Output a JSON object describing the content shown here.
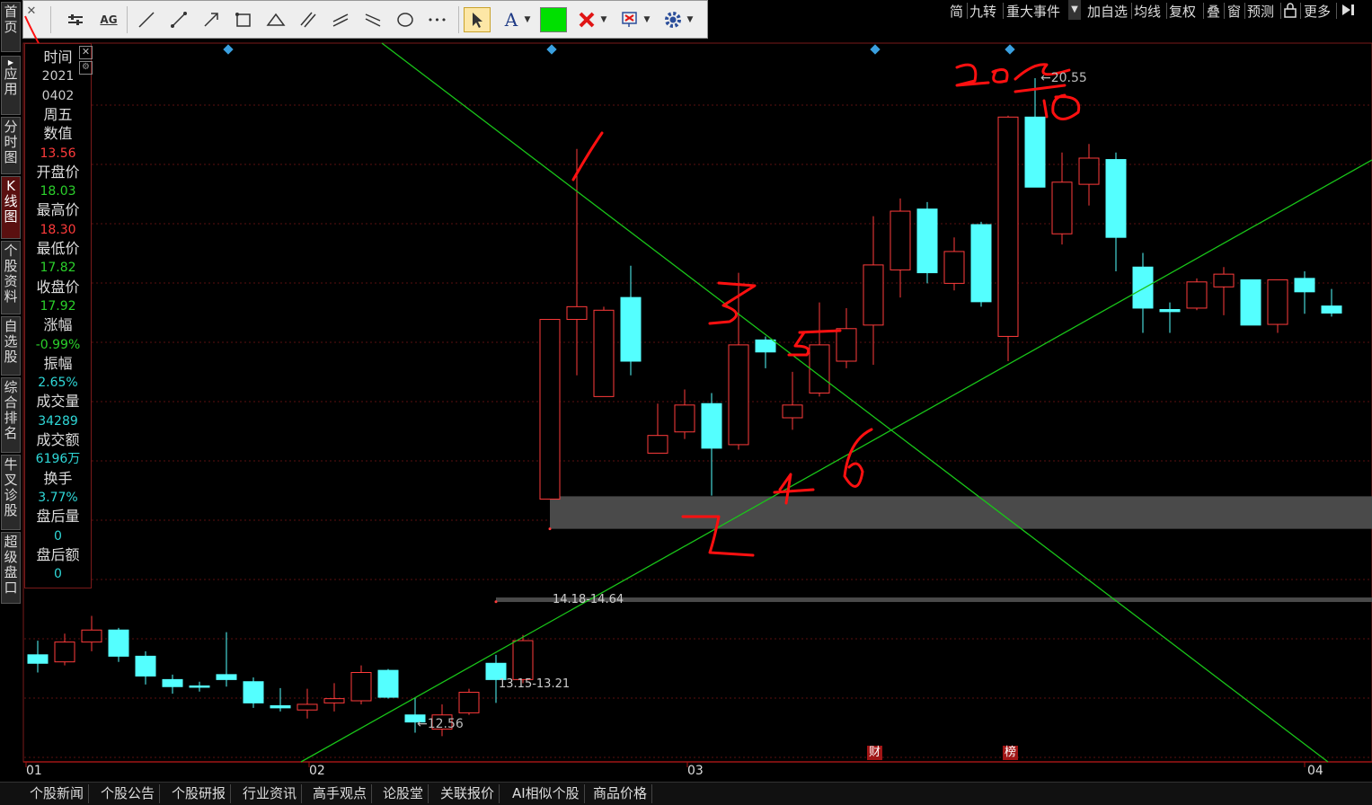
{
  "left_nav": [
    {
      "label": "首页",
      "active": false
    },
    {
      "label": "应用",
      "active": false,
      "arrow": true
    },
    {
      "label": "分时图",
      "active": false
    },
    {
      "label": "K线图",
      "active": true
    },
    {
      "label": "个股资料",
      "active": false
    },
    {
      "label": "自选股",
      "active": false
    },
    {
      "label": "综合排名",
      "active": false
    },
    {
      "label": "牛叉诊股",
      "active": false
    },
    {
      "label": "超级盘口",
      "active": false
    }
  ],
  "toolbar": {
    "close": "✕",
    "text_tool": "A",
    "ag_label": "AG",
    "more": "•••",
    "color": "#00e000"
  },
  "top_menu": [
    "简",
    "九转",
    "重大事件",
    "加自选",
    "均线",
    "复权",
    "叠",
    "窗",
    "预测",
    "更多"
  ],
  "info_panel": {
    "rows": [
      {
        "label": "时间",
        "value": null
      },
      {
        "label": null,
        "value": "2021",
        "color": "white"
      },
      {
        "label": null,
        "value": "0402",
        "color": "white"
      },
      {
        "label": null,
        "value": "周五",
        "color": "label"
      },
      {
        "label": "数值",
        "value": "13.56",
        "color": "red"
      },
      {
        "label": "开盘价",
        "value": "18.03",
        "color": "green"
      },
      {
        "label": "最高价",
        "value": "18.30",
        "color": "red"
      },
      {
        "label": "最低价",
        "value": "17.82",
        "color": "green"
      },
      {
        "label": "收盘价",
        "value": "17.92",
        "color": "green"
      },
      {
        "label": "涨幅",
        "value": "-0.99%",
        "color": "green"
      },
      {
        "label": "振幅",
        "value": "2.65%",
        "color": "cyan"
      },
      {
        "label": "成交量",
        "value": "34289",
        "color": "cyan"
      },
      {
        "label": "成交额",
        "value": "6196万",
        "color": "cyan"
      },
      {
        "label": "换手",
        "value": "3.77%",
        "color": "cyan"
      },
      {
        "label": "盘后量",
        "value": "0",
        "color": "cyan"
      },
      {
        "label": "盘后额",
        "value": "0",
        "color": "cyan"
      }
    ]
  },
  "bottom_tabs": [
    "个股新闻",
    "个股公告",
    "个股研报",
    "行业资讯",
    "高手观点",
    "论股堂",
    "关联报价",
    "AI相似个股",
    "商品价格"
  ],
  "chart_data": {
    "type": "candlestick",
    "x_axis_labels": [
      "01",
      "02",
      "03",
      "04"
    ],
    "price_labels": [
      "20.55",
      "12.56"
    ],
    "zones": [
      {
        "label": "14.18-14.64",
        "low": 14.18,
        "high": 14.64
      },
      {
        "label": "13.15-13.21",
        "low": 13.15,
        "high": 13.21
      }
    ],
    "event_markers": [
      "财",
      "榜"
    ],
    "candles": [
      {
        "o": 12.4,
        "c": 12.28,
        "h": 12.6,
        "l": 12.15
      },
      {
        "o": 12.3,
        "c": 12.58,
        "h": 12.7,
        "l": 12.25
      },
      {
        "o": 12.58,
        "c": 12.75,
        "h": 12.95,
        "l": 12.45
      },
      {
        "o": 12.75,
        "c": 12.38,
        "h": 12.78,
        "l": 12.3
      },
      {
        "o": 12.38,
        "c": 12.1,
        "h": 12.45,
        "l": 11.98
      },
      {
        "o": 12.05,
        "c": 11.95,
        "h": 12.12,
        "l": 11.85
      },
      {
        "o": 11.96,
        "c": 11.95,
        "h": 12.02,
        "l": 11.88
      },
      {
        "o": 12.12,
        "c": 12.05,
        "h": 12.72,
        "l": 11.95
      },
      {
        "o": 12.02,
        "c": 11.72,
        "h": 12.08,
        "l": 11.65
      },
      {
        "o": 11.68,
        "c": 11.65,
        "h": 11.93,
        "l": 11.6
      },
      {
        "o": 11.62,
        "c": 11.7,
        "h": 11.92,
        "l": 11.5
      },
      {
        "o": 11.72,
        "c": 11.78,
        "h": 12.0,
        "l": 11.6
      },
      {
        "o": 11.75,
        "c": 12.15,
        "h": 12.25,
        "l": 11.7
      },
      {
        "o": 12.18,
        "c": 11.8,
        "h": 12.2,
        "l": 11.78
      },
      {
        "o": 11.55,
        "c": 11.45,
        "h": 11.8,
        "l": 11.3
      },
      {
        "o": 11.35,
        "c": 11.55,
        "h": 11.7,
        "l": 11.25
      },
      {
        "o": 11.58,
        "c": 11.87,
        "h": 11.92,
        "l": 11.55
      },
      {
        "o": 12.28,
        "c": 12.05,
        "h": 12.4,
        "l": 11.72
      },
      {
        "o": 12.05,
        "c": 12.6,
        "h": 12.68,
        "l": 12.0
      },
      {
        "o": 14.6,
        "c": 17.14,
        "h": 17.14,
        "l": 14.6
      },
      {
        "o": 17.14,
        "c": 17.32,
        "h": 19.55,
        "l": 16.35
      },
      {
        "o": 16.05,
        "c": 17.27,
        "h": 17.32,
        "l": 16.05
      },
      {
        "o": 17.45,
        "c": 16.55,
        "h": 17.9,
        "l": 16.35
      },
      {
        "o": 15.25,
        "c": 15.5,
        "h": 15.95,
        "l": 15.25
      },
      {
        "o": 15.55,
        "c": 15.93,
        "h": 16.15,
        "l": 15.45
      },
      {
        "o": 15.95,
        "c": 15.32,
        "h": 16.1,
        "l": 14.65
      },
      {
        "o": 15.37,
        "c": 16.78,
        "h": 17.8,
        "l": 15.3
      },
      {
        "o": 16.85,
        "c": 16.68,
        "h": 16.9,
        "l": 16.45
      },
      {
        "o": 15.75,
        "c": 15.93,
        "h": 16.4,
        "l": 15.58
      },
      {
        "o": 16.1,
        "c": 16.78,
        "h": 17.38,
        "l": 16.05
      },
      {
        "o": 16.55,
        "c": 17.01,
        "h": 17.3,
        "l": 16.45
      },
      {
        "o": 17.06,
        "c": 17.91,
        "h": 18.6,
        "l": 16.5
      },
      {
        "o": 17.84,
        "c": 18.67,
        "h": 18.85,
        "l": 17.45
      },
      {
        "o": 18.7,
        "c": 17.8,
        "h": 18.8,
        "l": 17.65
      },
      {
        "o": 17.65,
        "c": 18.1,
        "h": 18.3,
        "l": 17.55
      },
      {
        "o": 18.48,
        "c": 17.39,
        "h": 18.52,
        "l": 17.32
      },
      {
        "o": 16.9,
        "c": 20.0,
        "h": 20.02,
        "l": 16.55
      },
      {
        "o": 20.0,
        "c": 19.01,
        "h": 20.55,
        "l": 19.01
      },
      {
        "o": 18.35,
        "c": 19.08,
        "h": 19.5,
        "l": 18.2
      },
      {
        "o": 19.05,
        "c": 19.42,
        "h": 19.62,
        "l": 18.75
      },
      {
        "o": 19.4,
        "c": 18.3,
        "h": 19.5,
        "l": 17.82
      },
      {
        "o": 17.88,
        "c": 17.3,
        "h": 18.08,
        "l": 16.95
      },
      {
        "o": 17.28,
        "c": 17.25,
        "h": 17.38,
        "l": 16.95
      },
      {
        "o": 17.3,
        "c": 17.67,
        "h": 17.72,
        "l": 17.27
      },
      {
        "o": 17.6,
        "c": 17.78,
        "h": 17.88,
        "l": 17.2
      },
      {
        "o": 17.7,
        "c": 17.06,
        "h": 17.7,
        "l": 17.06
      },
      {
        "o": 17.07,
        "c": 17.7,
        "h": 17.7,
        "l": 16.95
      },
      {
        "o": 17.72,
        "c": 17.53,
        "h": 17.82,
        "l": 17.22
      },
      {
        "o": 17.33,
        "c": 17.23,
        "h": 17.57,
        "l": 17.18
      }
    ],
    "handwritten": [
      "1",
      "2",
      "3",
      "4",
      "5",
      "6",
      "20",
      "10"
    ]
  }
}
